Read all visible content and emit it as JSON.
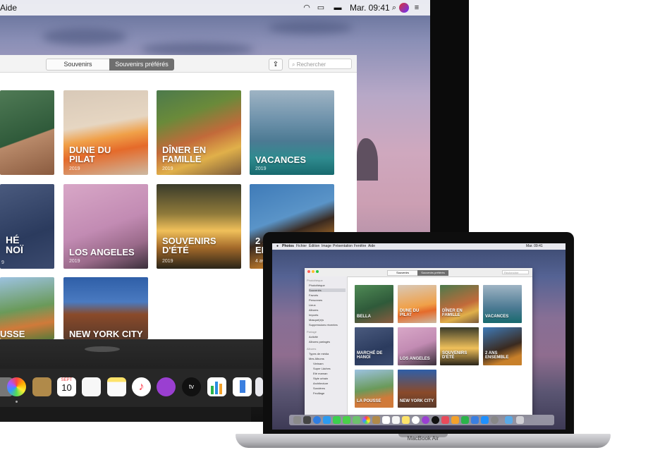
{
  "big_monitor": {
    "menubar": {
      "menu_item": "Aide",
      "time": "Mar. 09:41",
      "icons": [
        "wifi-icon",
        "airplay-icon",
        "battery-icon",
        "search-icon",
        "siri-icon",
        "control-icon"
      ]
    },
    "toolbar": {
      "tab_memories": "Souvenirs",
      "tab_favorites": "Souvenirs préférés",
      "search_placeholder": "Rechercher",
      "share_icon": "share-icon"
    },
    "tiles": [
      {
        "title": "",
        "year": ""
      },
      {
        "title": "DUNE DU PILAT",
        "year": "2019"
      },
      {
        "title": "DÎNER EN FAMILLE",
        "year": "2019"
      },
      {
        "title": "VACANCES",
        "year": "2019"
      },
      {
        "title": "HÉ NOÏ",
        "year": "9"
      },
      {
        "title": "LOS ANGELES",
        "year": "2019"
      },
      {
        "title": "SOUVENIRS D'ÉTÉ",
        "year": "2019"
      },
      {
        "title": "2 A EN",
        "year": "4 av"
      },
      {
        "title": "USSE",
        "year": ""
      },
      {
        "title": "NEW YORK CITY",
        "year": ""
      }
    ],
    "dock_apps": [
      "photos-icon",
      "notes-book-icon",
      "calendar-icon",
      "reminders-icon",
      "notes-icon",
      "music-icon",
      "podcasts-icon",
      "appletv-icon",
      "numbers-icon",
      "keynote-icon"
    ],
    "calendar_icon": {
      "month": "SEPT",
      "day": "10"
    }
  },
  "laptop": {
    "brand": "MacBook Air",
    "menubar": {
      "items": [
        "Photos",
        "Fichier",
        "Édition",
        "Image",
        "Présentation",
        "Fenêtre",
        "Aide"
      ],
      "time": "Mar. 09:41"
    },
    "toolbar": {
      "tab_memories": "Souvenirs",
      "tab_favorites": "Souvenirs préférés",
      "search_placeholder": "Rechercher"
    },
    "sidebar": {
      "section_library": "Photothèque",
      "library_items": [
        "Photothèque",
        "Souvenirs",
        "Favoris",
        "Personnes",
        "Lieux",
        "Albums",
        "Imports",
        "Masqué(e)s",
        "Suppressions récentes"
      ],
      "section_shared": "Partagé",
      "shared_items": [
        "Activité",
        "Albums partagés"
      ],
      "section_albums": "Albums",
      "album_items": [
        "Types de média",
        "Mes Albums",
        "Vietnam",
        "Super Lâches",
        "Eté maman",
        "Style urbain",
        "Architecture",
        "Sorcières",
        "Feuillage"
      ]
    },
    "tiles": [
      {
        "title": "BELLA"
      },
      {
        "title": "DUNE DU PILAT"
      },
      {
        "title": "DÎNER EN FAMILLE"
      },
      {
        "title": "VACANCES"
      },
      {
        "title": "MARCHÉ DE HANOÏ"
      },
      {
        "title": "LOS ANGELES"
      },
      {
        "title": "SOUVENIRS D'ÉTÉ"
      },
      {
        "title": "2 ANS ENSEMBLE"
      },
      {
        "title": "LA POUSSE"
      },
      {
        "title": "NEW YORK CITY"
      }
    ]
  },
  "colors": {
    "wallpaper_top": "#5d6a93",
    "wallpaper_mid": "#cfa8be",
    "selected_segment": "#6f6f6f"
  }
}
